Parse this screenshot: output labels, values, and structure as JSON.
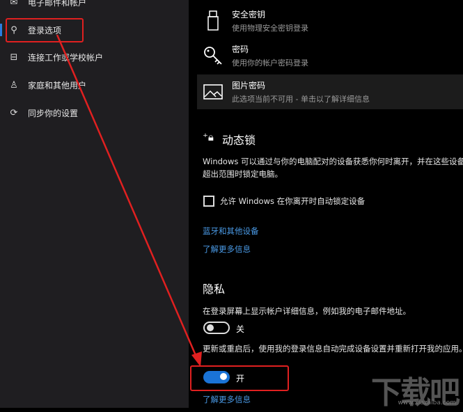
{
  "sidebar": {
    "items": [
      {
        "label": "电子邮件和帐户",
        "icon": "email-icon"
      },
      {
        "label": "登录选项",
        "icon": "key-icon",
        "selected": true
      },
      {
        "label": "连接工作或学校帐户",
        "icon": "briefcase-icon"
      },
      {
        "label": "家庭和其他用户",
        "icon": "person-icon"
      },
      {
        "label": "同步你的设置",
        "icon": "sync-icon"
      }
    ]
  },
  "options": [
    {
      "title": "安全密钥",
      "subtitle": "使用物理安全密钥登录",
      "icon": "usb-key-icon"
    },
    {
      "title": "密码",
      "subtitle": "使用你的帐户密码登录",
      "icon": "key-icon"
    },
    {
      "title": "图片密码",
      "subtitle": "此选项当前不可用 - 单击以了解详细信息",
      "icon": "picture-icon"
    }
  ],
  "dynamic_lock": {
    "title": "动态锁",
    "desc": "Windows 可以通过与你的电脑配对的设备获悉你何时离开，并在这些设备超出范围时锁定电脑。",
    "checkbox": "允许 Windows 在你离开时自动锁定设备",
    "checked": false,
    "link1": "蓝牙和其他设备",
    "link2": "了解更多信息"
  },
  "privacy": {
    "title": "隐私",
    "desc1": "在登录屏幕上显示帐户详细信息，例如我的电子邮件地址。",
    "toggle1": {
      "label": "关",
      "on": false
    },
    "desc2": "更新或重启后，使用我的登录信息自动完成设备设置并重新打开我的应用。",
    "toggle2": {
      "label": "开",
      "on": true
    },
    "link": "了解更多信息"
  },
  "watermark": {
    "logo": "下载吧",
    "url": "www.xiazaiba.com"
  },
  "colors": {
    "accent": "#1a73d6",
    "annotation": "#e02020"
  }
}
